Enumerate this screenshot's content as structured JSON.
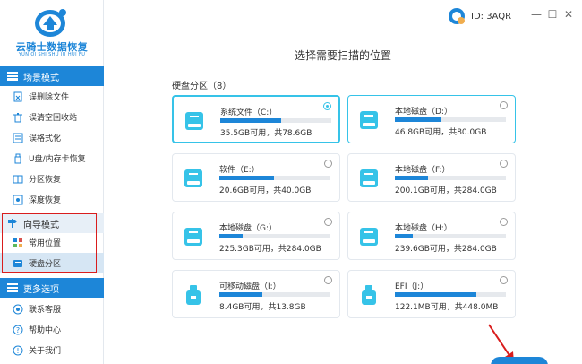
{
  "app": {
    "logo_title": "云骑士数据恢复",
    "logo_subtitle": "YUN QI SHI SHU JU HUI FU",
    "user_id": "ID: 3AQR"
  },
  "sidebar": {
    "scene_mode": "场景模式",
    "scene_items": [
      {
        "label": "误删除文件",
        "icon": "file-delete-icon"
      },
      {
        "label": "误清空回收站",
        "icon": "recycle-bin-icon"
      },
      {
        "label": "误格式化",
        "icon": "format-icon"
      },
      {
        "label": "U盘/内存卡恢复",
        "icon": "usb-card-icon"
      },
      {
        "label": "分区恢复",
        "icon": "partition-icon"
      },
      {
        "label": "深度恢复",
        "icon": "deep-scan-icon"
      }
    ],
    "guide_mode": "向导模式",
    "guide_items": [
      {
        "label": "常用位置",
        "icon": "common-location-icon"
      },
      {
        "label": "硬盘分区",
        "icon": "disk-partition-icon"
      }
    ],
    "more_options": "更多选项",
    "more_items": [
      {
        "label": "联系客服",
        "icon": "support-icon"
      },
      {
        "label": "帮助中心",
        "icon": "help-icon"
      },
      {
        "label": "关于我们",
        "icon": "info-icon"
      }
    ]
  },
  "main": {
    "title": "选择需要扫描的位置",
    "partition_label": "硬盘分区（8）",
    "drives": [
      {
        "name": "系统文件（C:）",
        "size": "35.5GB可用，共78.6GB",
        "used_fraction": 0.55,
        "type": "hdd",
        "selected": true
      },
      {
        "name": "本地磁盘（D:）",
        "size": "46.8GB可用，共80.0GB",
        "used_fraction": 0.42,
        "type": "hdd",
        "selected": false
      },
      {
        "name": "软件（E:）",
        "size": "20.6GB可用，共40.0GB",
        "used_fraction": 0.49,
        "type": "hdd",
        "selected": false
      },
      {
        "name": "本地磁盘（F:）",
        "size": "200.1GB可用，共284.0GB",
        "used_fraction": 0.3,
        "type": "hdd",
        "selected": false
      },
      {
        "name": "本地磁盘（G:）",
        "size": "225.3GB可用，共284.0GB",
        "used_fraction": 0.21,
        "type": "hdd",
        "selected": false
      },
      {
        "name": "本地磁盘（H:）",
        "size": "239.6GB可用，共284.0GB",
        "used_fraction": 0.16,
        "type": "hdd",
        "selected": false
      },
      {
        "name": "可移动磁盘（I:）",
        "size": "8.4GB可用，共13.8GB",
        "used_fraction": 0.39,
        "type": "usb",
        "selected": false
      },
      {
        "name": "EFI（J:）",
        "size": "122.1MB可用，共448.0MB",
        "used_fraction": 0.73,
        "type": "usb",
        "selected": false
      }
    ]
  },
  "colors": {
    "accent": "#1d86d8",
    "highlight": "#36c3e8",
    "annotation": "#d91d1d"
  }
}
